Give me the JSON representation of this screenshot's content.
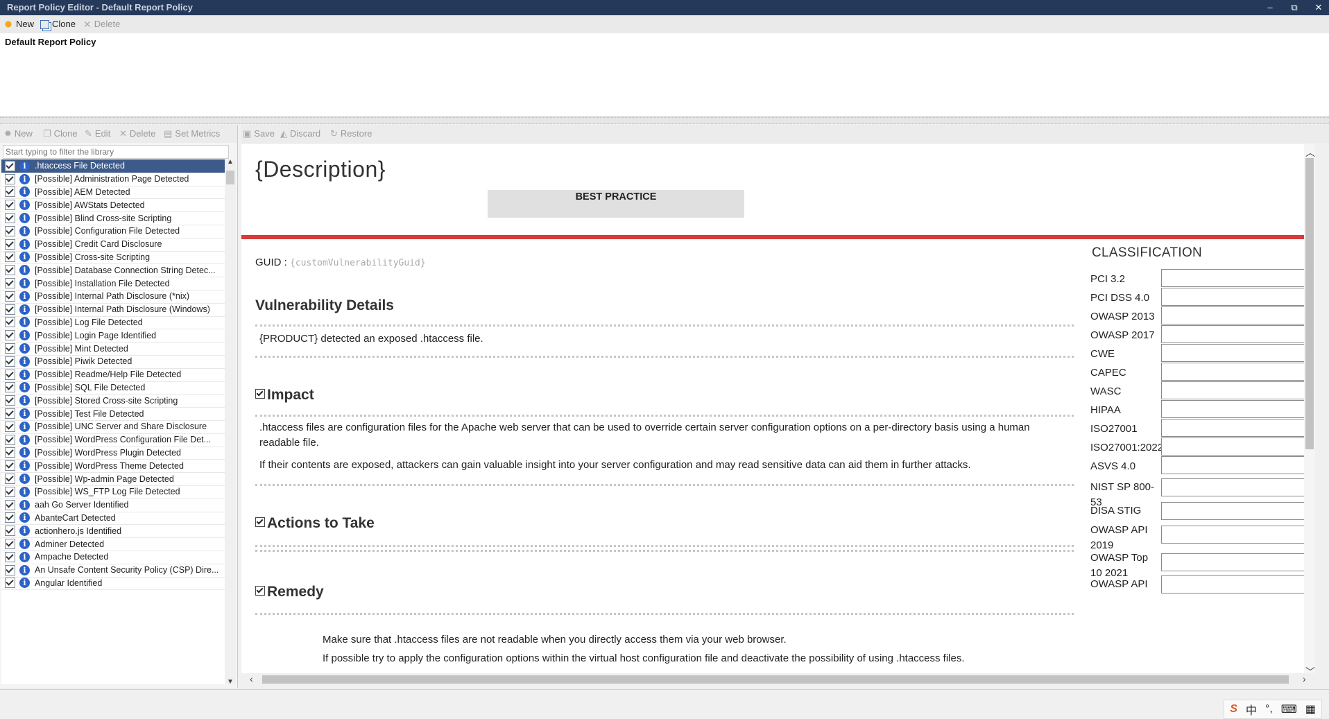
{
  "window": {
    "title": "Report Policy Editor - Default Report Policy",
    "controls": {
      "minimize": "–",
      "restore": "⧉",
      "close": "✕"
    }
  },
  "top_toolbar": {
    "new_label": "New",
    "clone_label": "Clone",
    "delete_label": "Delete"
  },
  "policy": {
    "name": "Default Report Policy"
  },
  "library_toolbar": {
    "new_label": "New",
    "clone_label": "Clone",
    "edit_label": "Edit",
    "delete_label": "Delete",
    "set_metrics_label": "Set Metrics"
  },
  "library": {
    "filter_placeholder": "Start typing to filter the library",
    "items": [
      ".htaccess File Detected",
      "[Possible] Administration Page Detected",
      "[Possible] AEM Detected",
      "[Possible] AWStats Detected",
      "[Possible] Blind Cross-site Scripting",
      "[Possible] Configuration File Detected",
      "[Possible] Credit Card Disclosure",
      "[Possible] Cross-site Scripting",
      "[Possible] Database Connection String Detec...",
      "[Possible] Installation File Detected",
      "[Possible] Internal Path Disclosure (*nix)",
      "[Possible] Internal Path Disclosure (Windows)",
      "[Possible] Log File Detected",
      "[Possible] Login Page Identified",
      "[Possible] Mint Detected",
      "[Possible] Piwik Detected",
      "[Possible] Readme/Help File Detected",
      "[Possible] SQL File Detected",
      "[Possible] Stored Cross-site Scripting",
      "[Possible] Test File Detected",
      "[Possible] UNC Server and Share Disclosure",
      "[Possible] WordPress Configuration File Det...",
      "[Possible] WordPress Plugin Detected",
      "[Possible] WordPress Theme Detected",
      "[Possible] Wp-admin Page Detected",
      "[Possible] WS_FTP Log File Detected",
      "aah Go Server Identified",
      "AbanteCart Detected",
      "actionhero.js Identified",
      "Adminer Detected",
      "Ampache Detected",
      "An Unsafe Content Security Policy (CSP) Dire...",
      "Angular Identified"
    ],
    "selected_index": 0
  },
  "editor_toolbar": {
    "save_label": "Save",
    "discard_label": "Discard",
    "restore_label": "Restore"
  },
  "document": {
    "description": "{Description}",
    "severity_badge": "BEST PRACTICE",
    "guid_label": "GUID :",
    "guid_value": "{customVulnerabilityGuid}",
    "vuln_details_title": "Vulnerability Details",
    "vuln_details_text": "{PRODUCT} detected an exposed .htaccess file.",
    "impact_title": "Impact",
    "impact_p1": ".htaccess files are configuration files for the Apache web server that can be used to override certain server configuration options on a per-directory basis using a human readable file.",
    "impact_p2": "If their contents are exposed, attackers can gain valuable insight into your server configuration and may read sensitive data can aid them in further attacks.",
    "actions_title": "Actions to Take",
    "remedy_title": "Remedy",
    "remedy_p1": "Make sure that .htaccess files are not readable when you directly access them via your web browser.",
    "remedy_p2": "If possible try to apply the configuration options within the virtual host configuration file and deactivate the possibility of using .htaccess files."
  },
  "classification": {
    "header": "CLASSIFICATION",
    "labels": [
      "PCI 3.2",
      "PCI DSS 4.0",
      "OWASP 2013",
      "OWASP 2017",
      "CWE",
      "CAPEC",
      "WASC",
      "HIPAA",
      "ISO27001",
      "ISO27001:2022",
      "ASVS 4.0",
      "NIST SP 800-53",
      "DISA STIG",
      "OWASP API 2019",
      "OWASP Top 10 2021",
      "OWASP API"
    ]
  },
  "tray": {
    "ime": "中",
    "icons": [
      "sogou-icon",
      "punctuation-icon",
      "keyboard-icon",
      "grid-icon"
    ]
  },
  "colors": {
    "titlebar": "#25395a",
    "selection": "#3c5a8a",
    "severity_bar": "#d93a3a",
    "info_icon": "#2c63c7"
  }
}
